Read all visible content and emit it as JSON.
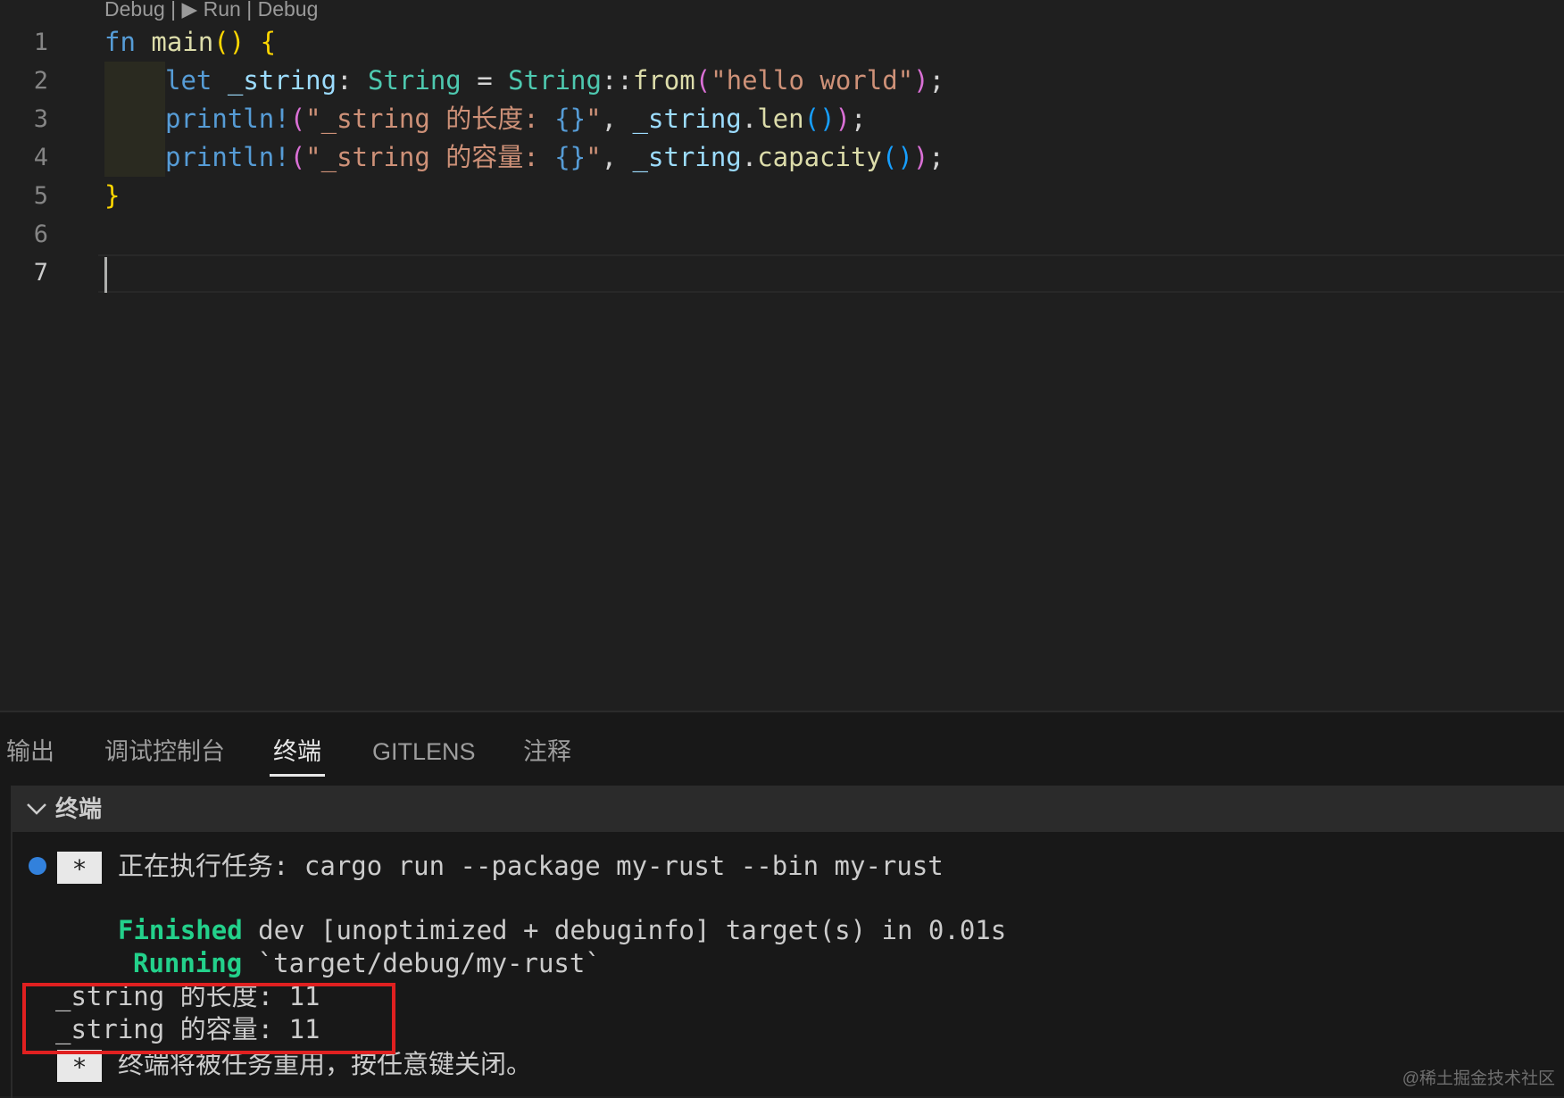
{
  "codelens": {
    "debug1": "Debug",
    "sep1": " | ",
    "run": "▶ Run",
    "sep2": " | ",
    "debug2": "Debug"
  },
  "editor": {
    "line_numbers": [
      "1",
      "2",
      "3",
      "4",
      "5",
      "6",
      "7"
    ],
    "tokens": {
      "fn": "fn",
      "main": "main",
      "open_paren": "(",
      "close_paren": ")",
      "open_brace": "{",
      "close_brace": "}",
      "let": "let",
      "string_var": "_string",
      "colon": ": ",
      "string_type": "String",
      "eq": " = ",
      "string_type2": "String",
      "coloncolon": "::",
      "from": "from",
      "hello": "\"hello world\"",
      "semi": ";",
      "println": "println!",
      "str3_a": "\"_string 的长度: ",
      "str4_a": "\"_string 的容量: ",
      "placeholder": "{}",
      "quote": "\"",
      "comma": ", ",
      "dot": ".",
      "len": "len",
      "capacity": "capacity",
      "empty_call": "()"
    }
  },
  "panel": {
    "tabs": [
      "输出",
      "调试控制台",
      "终端",
      "GITLENS",
      "注释"
    ],
    "active_tab": "终端",
    "terminal_title": "终端",
    "task_star": "*",
    "task_line": "正在执行任务: cargo run --package my-rust --bin my-rust",
    "finished_word": "Finished",
    "finished_rest": " dev [unoptimized + debuginfo] target(s) in 0.01s",
    "running_word": "Running",
    "running_rest": " `target/debug/my-rust`",
    "output_len": "_string 的长度: 11",
    "output_cap": "_string 的容量: 11",
    "reuse_star": "*",
    "reuse_line": "终端将被任务重用，按任意键关闭。"
  },
  "watermark": "@稀土掘金技术社区",
  "colors": {
    "highlight_box": "#e02020",
    "finished_green": "#23d18b",
    "task_dot": "#3794ff"
  },
  "icons": {
    "chevron": "chevron-down-icon",
    "task": "circle-icon"
  }
}
